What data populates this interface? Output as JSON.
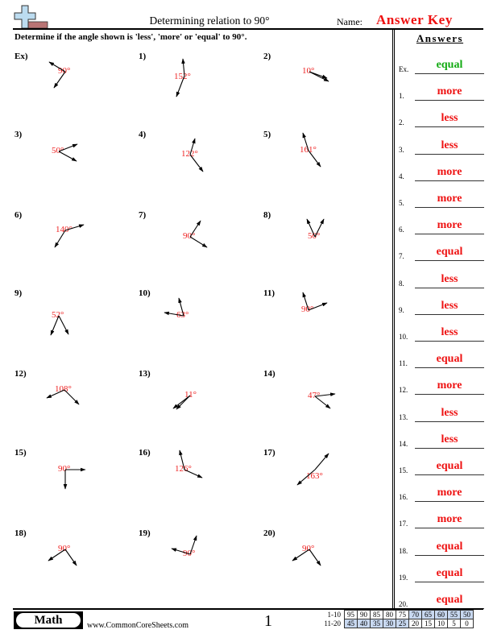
{
  "header": {
    "title": "Determining relation to 90°",
    "name_label": "Name:",
    "name_value": "Answer Key",
    "logo_icon": "plus-ruler-logo-icon"
  },
  "instructions": "Determine if the angle shown is 'less', 'more' or 'equal' to 90°.",
  "problems": [
    {
      "label": "Ex)",
      "angle": "90°"
    },
    {
      "label": "1)",
      "angle": "152°"
    },
    {
      "label": "2)",
      "angle": "10°"
    },
    {
      "label": "3)",
      "angle": "50°"
    },
    {
      "label": "4)",
      "angle": "122°"
    },
    {
      "label": "5)",
      "angle": "161°"
    },
    {
      "label": "6)",
      "angle": "140°"
    },
    {
      "label": "7)",
      "angle": "90°"
    },
    {
      "label": "8)",
      "angle": "50°"
    },
    {
      "label": "9)",
      "angle": "52°"
    },
    {
      "label": "10)",
      "angle": "63°"
    },
    {
      "label": "11)",
      "angle": "90°"
    },
    {
      "label": "12)",
      "angle": "108°"
    },
    {
      "label": "13)",
      "angle": "11°"
    },
    {
      "label": "14)",
      "angle": "47°"
    },
    {
      "label": "15)",
      "angle": "90°"
    },
    {
      "label": "16)",
      "angle": "126°"
    },
    {
      "label": "17)",
      "angle": "163°"
    },
    {
      "label": "18)",
      "angle": "90°"
    },
    {
      "label": "19)",
      "angle": "90°"
    },
    {
      "label": "20)",
      "angle": "90°"
    }
  ],
  "answers": {
    "heading": "Answers",
    "items": [
      {
        "num": "Ex.",
        "value": "equal"
      },
      {
        "num": "1.",
        "value": "more"
      },
      {
        "num": "2.",
        "value": "less"
      },
      {
        "num": "3.",
        "value": "less"
      },
      {
        "num": "4.",
        "value": "more"
      },
      {
        "num": "5.",
        "value": "more"
      },
      {
        "num": "6.",
        "value": "more"
      },
      {
        "num": "7.",
        "value": "equal"
      },
      {
        "num": "8.",
        "value": "less"
      },
      {
        "num": "9.",
        "value": "less"
      },
      {
        "num": "10.",
        "value": "less"
      },
      {
        "num": "11.",
        "value": "equal"
      },
      {
        "num": "12.",
        "value": "more"
      },
      {
        "num": "13.",
        "value": "less"
      },
      {
        "num": "14.",
        "value": "less"
      },
      {
        "num": "15.",
        "value": "equal"
      },
      {
        "num": "16.",
        "value": "more"
      },
      {
        "num": "17.",
        "value": "more"
      },
      {
        "num": "18.",
        "value": "equal"
      },
      {
        "num": "19.",
        "value": "equal"
      },
      {
        "num": "20.",
        "value": "equal"
      }
    ]
  },
  "footer": {
    "subject": "Math",
    "website": "www.CommonCoreSheets.com",
    "page": "1",
    "score_rows": [
      {
        "label": "1-10",
        "values": [
          "95",
          "90",
          "85",
          "80",
          "75",
          "70",
          "65",
          "60",
          "55",
          "50"
        ]
      },
      {
        "label": "11-20",
        "values": [
          "45",
          "40",
          "35",
          "30",
          "25",
          "20",
          "15",
          "10",
          "5",
          "0"
        ]
      }
    ]
  },
  "colors": {
    "answer_red": "#ee1111",
    "example_green": "#11aa11",
    "degree_label": "#ee2222",
    "score_highlight": "#c8d8f0"
  }
}
